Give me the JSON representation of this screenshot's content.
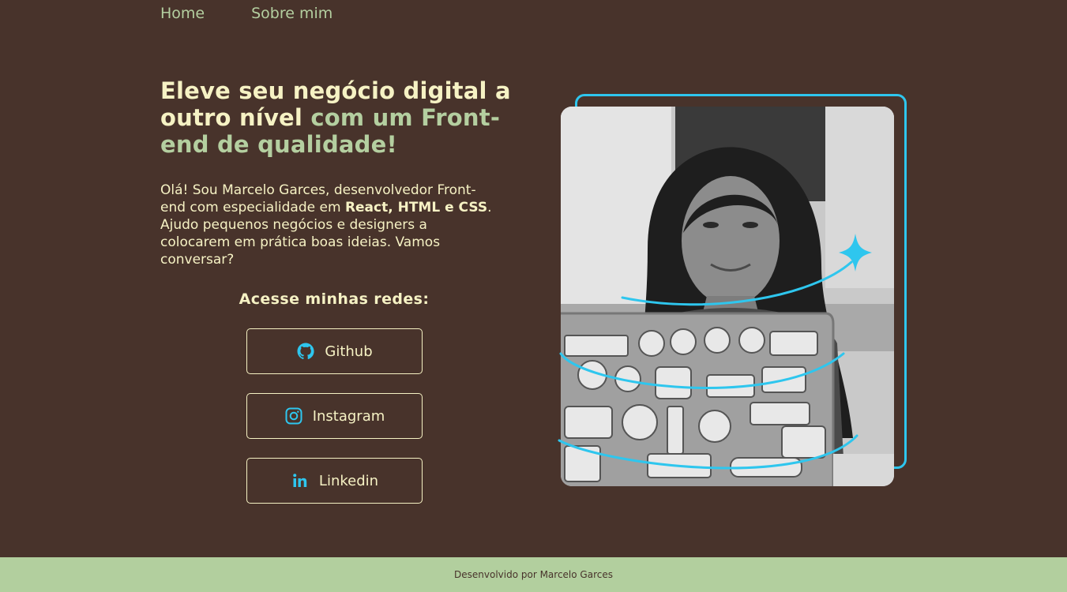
{
  "nav": {
    "home": "Home",
    "about": "Sobre mim"
  },
  "hero": {
    "title_light": "Eleve seu negócio digital a outro nível ",
    "title_green": "com um Front-end de qualidade!",
    "intro_part1": "Olá! Sou Marcelo Garces, desenvolvedor Front-end com especialidade em ",
    "intro_bold": "React, HTML e CSS",
    "intro_part2": ". Ajudo pequenos negócios e designers a colocarem em prática boas ideias. Vamos conversar?"
  },
  "social": {
    "title": "Acesse minhas redes:",
    "github": "Github",
    "instagram": "Instagram",
    "linkedin": "Linkedin"
  },
  "image": {
    "alt": "Mulher sorrindo usando notebook com adesivos"
  },
  "footer": {
    "text": "Desenvolvido por Marcelo Garces"
  },
  "colors": {
    "background": "#48332b",
    "cream": "#f6f2c4",
    "green": "#b4cfa0",
    "accent": "#2ec6ee",
    "footer": "#b2cf9e"
  },
  "icons": [
    "github-icon",
    "instagram-icon",
    "linkedin-icon",
    "sparkle-icon"
  ]
}
